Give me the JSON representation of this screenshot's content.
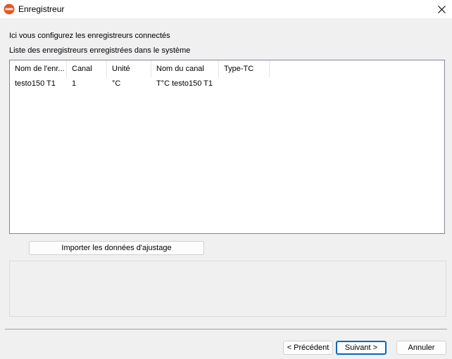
{
  "window": {
    "title": "Enregistreur"
  },
  "description": {
    "line1": "Ici vous configurez les enregistreurs connectés",
    "line2": "Liste des enregistreurs enregistrées dans le système"
  },
  "list": {
    "columns": [
      "Nom de l'enr...",
      "Canal",
      "Unité",
      "Nom du canal",
      "Type-TC"
    ],
    "rows": [
      [
        "testo150 T1",
        "1",
        "°C",
        "T°C testo150 T1",
        ""
      ]
    ]
  },
  "buttons": {
    "import": "Importer les données d'ajustage",
    "previous": "< Précédent",
    "next": "Suivant >",
    "cancel": "Annuler"
  },
  "icons": {
    "app": "testo-logo-icon",
    "close": "close-icon"
  },
  "colors": {
    "brand_orange": "#e8561f",
    "default_button_border": "#0067c0"
  }
}
